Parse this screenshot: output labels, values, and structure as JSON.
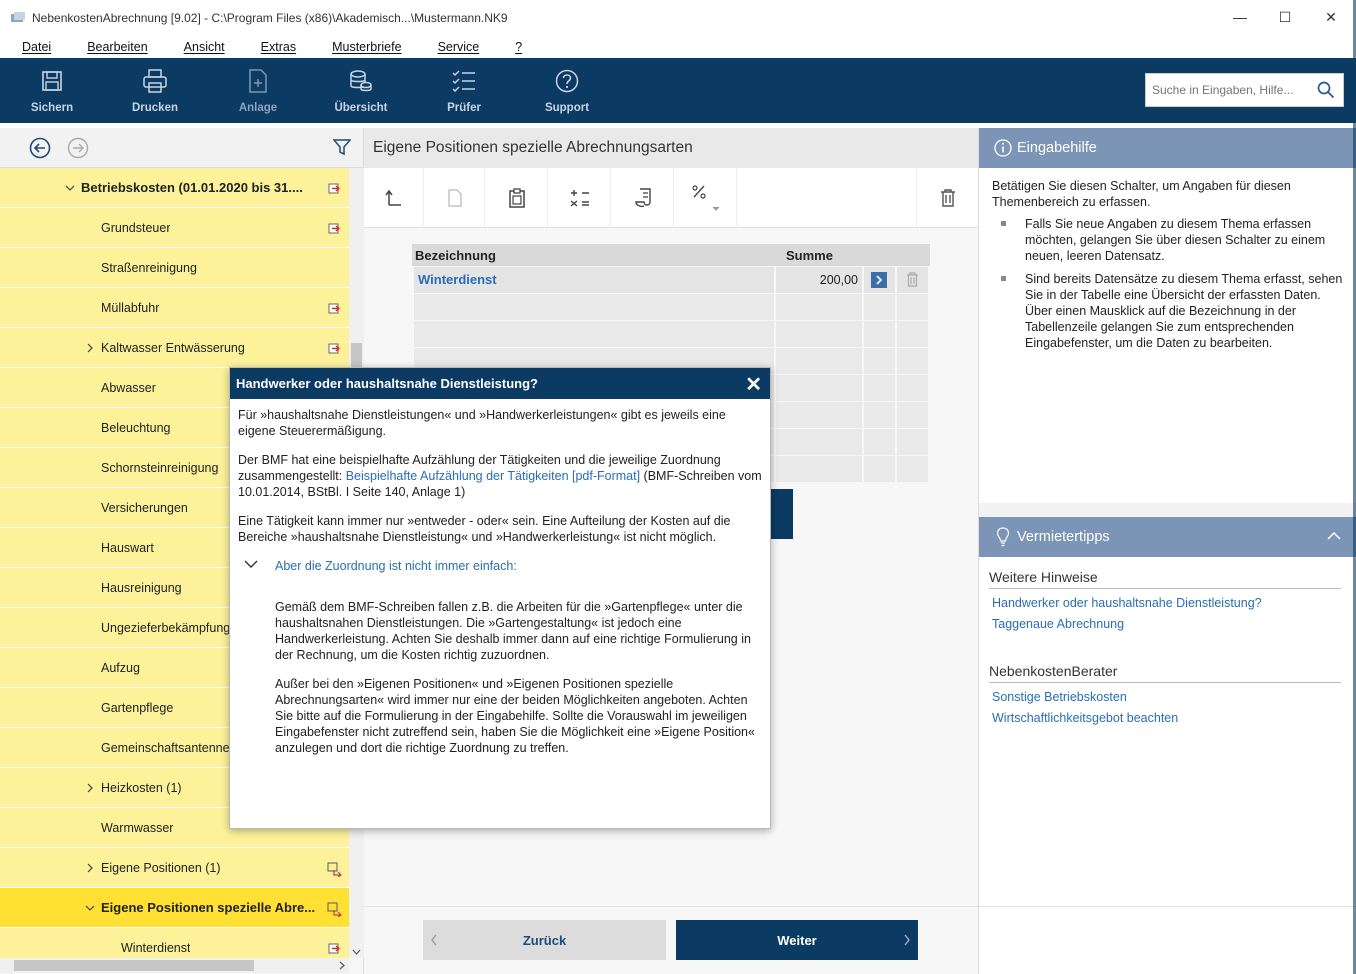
{
  "window": {
    "title": "NebenkostenAbrechnung [9.02] - C:\\Program Files (x86)\\Akademisch...\\Mustermann.NK9",
    "minimize": "—",
    "maximize": "☐",
    "close": "✕"
  },
  "menu": [
    "Datei",
    "Bearbeiten",
    "Ansicht",
    "Extras",
    "Musterbriefe",
    "Service",
    "?"
  ],
  "toolbar": {
    "buttons": [
      {
        "label": "Sichern",
        "icon": "save-icon"
      },
      {
        "label": "Drucken",
        "icon": "print-icon"
      },
      {
        "label": "Anlage",
        "icon": "new-document-icon"
      },
      {
        "label": "Übersicht",
        "icon": "coins-icon"
      },
      {
        "label": "Prüfer",
        "icon": "checklist-icon"
      },
      {
        "label": "Support",
        "icon": "help-icon"
      }
    ],
    "search_placeholder": "Suche in Eingaben, Hilfe..."
  },
  "tree": {
    "items": [
      {
        "label": "Betriebskosten (01.01.2020 bis 31....",
        "level": 0,
        "expanded": true,
        "bold": true,
        "flag": true
      },
      {
        "label": "Grundsteuer",
        "level": 1,
        "flag": true
      },
      {
        "label": "Straßenreinigung",
        "level": 1
      },
      {
        "label": "Müllabfuhr",
        "level": 1,
        "flag": true
      },
      {
        "label": "Kaltwasser Entwässerung",
        "level": 1,
        "collapsed": true,
        "flag": true
      },
      {
        "label": "Abwasser",
        "level": 1
      },
      {
        "label": "Beleuchtung",
        "level": 1
      },
      {
        "label": "Schornsteinreinigung",
        "level": 1
      },
      {
        "label": "Versicherungen",
        "level": 1
      },
      {
        "label": "Hauswart",
        "level": 1
      },
      {
        "label": "Hausreinigung",
        "level": 1
      },
      {
        "label": "Ungezieferbekämpfung",
        "level": 1
      },
      {
        "label": "Aufzug",
        "level": 1
      },
      {
        "label": "Gartenpflege",
        "level": 1
      },
      {
        "label": "Gemeinschaftsantenne",
        "level": 1
      },
      {
        "label": "Heizkosten (1)",
        "level": 1,
        "collapsed": true
      },
      {
        "label": "Warmwasser",
        "level": 1
      },
      {
        "label": "Eigene Positionen (1)",
        "level": 1,
        "collapsed": true,
        "flag2": true
      },
      {
        "label": "Eigene Positionen spezielle Abre...",
        "level": 1,
        "expanded": true,
        "selected": true,
        "bold": true,
        "flag2": true
      },
      {
        "label": "Winterdienst",
        "level": 2,
        "flag": true
      }
    ]
  },
  "center": {
    "title": "Eigene Positionen spezielle Abrechnungsarten",
    "table": {
      "headers": [
        "Bezeichnung",
        "Summe"
      ],
      "rows": [
        {
          "name": "Winterdienst",
          "sum": "200,00"
        }
      ]
    },
    "back_label": "Zurück",
    "next_label": "Weiter"
  },
  "help": {
    "title": "Eingabehilfe",
    "intro": "Betätigen Sie diesen Schalter, um Angaben für diesen Themenbereich zu erfassen.",
    "bullets": [
      "Falls Sie neue Angaben zu diesem Thema erfassen möchten, gelangen Sie über diesen Schalter zu einem neuen, leeren Datensatz.",
      "Sind bereits Datensätze zu diesem Thema erfasst, sehen Sie in der Tabelle eine Übersicht der erfassten Daten. Über einen Mausklick auf die Bezeichnung in der Tabellenzeile gelangen Sie zum entsprechenden Eingabefenster, um die Daten zu bearbeiten."
    ]
  },
  "tips": {
    "title": "Vermietertipps",
    "section1": "Weitere Hinweise",
    "links1": [
      "Handwerker oder haushaltsnahe Dienstleistung?",
      "Taggenaue Abrechnung"
    ],
    "section2": "NebenkostenBerater",
    "links2": [
      "Sonstige Betriebskosten",
      "Wirtschaftlichkeitsgebot beachten"
    ]
  },
  "modal": {
    "title": "Handwerker oder haushaltsnahe Dienstleistung?",
    "p1": "Für »haushaltsnahe Dienstleistungen« und »Handwerkerleistungen« gibt es jeweils eine eigene Steuerermäßigung.",
    "p2_pre": "Der BMF hat eine beispielhafte Aufzählung der Tätigkeiten und die jeweilige Zuordnung zusammengestellt: ",
    "p2_link": "Beispielhafte Aufzählung der Tätigkeiten [pdf-Format]",
    "p2_post": " (BMF-Schreiben vom 10.01.2014, BStBl. I Seite 140, Anlage 1)",
    "p3": "Eine Tätigkeit kann immer nur »entweder - oder« sein. Eine Aufteilung der Kosten auf die Bereiche »haushaltsnahe Dienstleistung« und »Handwerkerleistung« ist nicht möglich.",
    "accordion_title": "Aber die Zuordnung ist nicht immer einfach:",
    "acc_p1": "Gemäß dem BMF-Schreiben fallen z.B. die Arbeiten für die »Gartenpflege« unter die haushaltsnahen Dienstleistungen. Die »Gartengestaltung« ist jedoch eine Handwerkerleistung. Achten Sie deshalb immer dann auf eine richtige Formulierung in der Rechnung, um die Kosten richtig zuzuordnen.",
    "acc_p2": "Außer bei den »Eigenen Positionen« und »Eigenen Positionen spezielle Abrechnungsarten« wird immer nur eine der beiden Möglichkeiten angeboten. Achten Sie bitte auf die Formulierung in der Eingabehilfe. Sollte die Vorauswahl im jeweiligen Eingabefenster nicht zutreffend sein, haben Sie die Möglichkeit eine »Eigene Position« anzulegen und dort die richtige Zuordnung zu treffen."
  }
}
